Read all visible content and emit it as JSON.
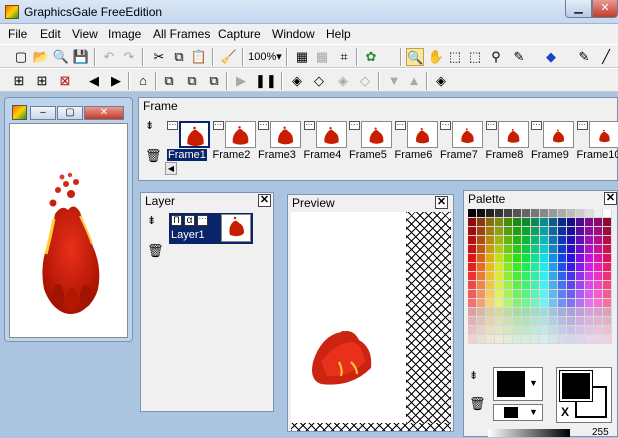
{
  "window": {
    "title": "GraphicsGale FreeEdition",
    "min_glyph": "▁",
    "close_glyph": "✕"
  },
  "menu": [
    "File",
    "Edit",
    "View",
    "Image",
    "All Frames",
    "Capture",
    "Window",
    "Help"
  ],
  "toolbar": {
    "zoom_value": "100%"
  },
  "frame_panel": {
    "title": "Frame",
    "frames": [
      "Frame1",
      "Frame2",
      "Frame3",
      "Frame4",
      "Frame5",
      "Frame6",
      "Frame7",
      "Frame8",
      "Frame9",
      "Frame10"
    ],
    "selected_index": 0
  },
  "layer_panel": {
    "title": "Layer",
    "layer_name": "Layer1",
    "flag_glyph": "Π",
    "alpha_glyph": "α"
  },
  "preview_panel": {
    "title": "Preview"
  },
  "palette_panel": {
    "title": "Palette",
    "bg_letter": "X",
    "value_text": "255"
  },
  "colors": {
    "selection": "#0a246a",
    "panel_bg": "#f0f0f0",
    "mdi_bg": "#abc4e0",
    "fire_dark": "#c81e00",
    "fire_light": "#ffcc33"
  },
  "dots": "···"
}
